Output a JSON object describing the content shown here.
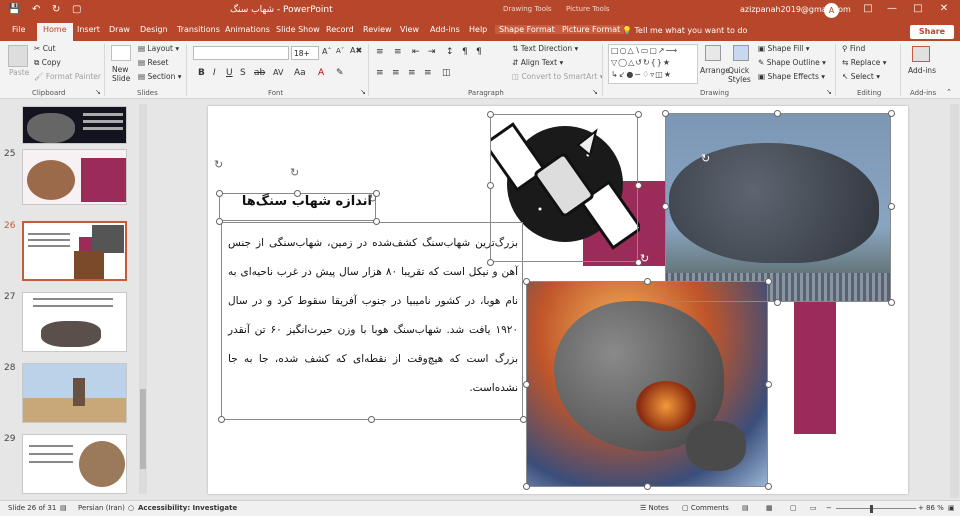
{
  "titlebar": {
    "doc_title": "شهاب سنگ  -  PowerPoint",
    "drawing_tools": "Drawing Tools",
    "picture_tools": "Picture Tools",
    "account": "azizpanah2019@gmail.com",
    "avatar_letter": "A"
  },
  "tabs": [
    "File",
    "Home",
    "Insert",
    "Draw",
    "Design",
    "Transitions",
    "Animations",
    "Slide Show",
    "Record",
    "Review",
    "View",
    "Add-ins",
    "Help",
    "Shape Format",
    "Picture Format"
  ],
  "tellme": "Tell me what you want to do",
  "share": "Share",
  "ribbon": {
    "paste": "Paste",
    "cut": "Cut",
    "copy": "Copy",
    "format_painter": "Format Painter",
    "new_slide": "New Slide",
    "layout": "Layout",
    "reset": "Reset",
    "section": "Section",
    "font_size": "18+",
    "text_direction": "Text Direction",
    "align_text": "Align Text",
    "smartart": "Convert to SmartArt",
    "arrange": "Arrange",
    "quick_styles": "Quick Styles",
    "shape_fill": "Shape Fill",
    "shape_outline": "Shape Outline",
    "shape_effects": "Shape Effects",
    "find": "Find",
    "replace": "Replace",
    "select": "Select",
    "addins": "Add-ins",
    "groups": [
      "Clipboard",
      "Slides",
      "Font",
      "Paragraph",
      "Drawing",
      "Editing",
      "Add-ins"
    ]
  },
  "thumbnails": [
    {
      "number": "25"
    },
    {
      "number": "26"
    },
    {
      "number": "27"
    },
    {
      "number": "28"
    },
    {
      "number": "29"
    }
  ],
  "slide": {
    "title": "اندازه شهاب سنگ‌ها",
    "body": "بزرگ‌ترین شهاب‌سنگ کشف‌شده در زمین، شهاب‌سنگی از جنس آهن و نیکل است که تقریبا ۸۰ هزار سال پیش در غرب ناحیه‌ای به نام هوبا، در کشور نامیبیا در جنوب آفریقا سقوط کرد و در سال ۱۹۲۰ یافت شد. شهاب‌سنگ هوبا با وزن حیرت‌انگیز ۶۰ تن آنقدر بزرگ است که هیچ‌وقت از نقطه‌ای که کشف شده، جا به جا نشده‌است.",
    "colors": {
      "accent": "#9b2c5a",
      "brand": "#b7472a"
    }
  },
  "status": {
    "slide_count": "Slide 26 of 31",
    "language": "Persian (Iran)",
    "accessibility": "Accessibility: Investigate",
    "notes": "Notes",
    "comments": "Comments",
    "zoom": "86 %"
  }
}
